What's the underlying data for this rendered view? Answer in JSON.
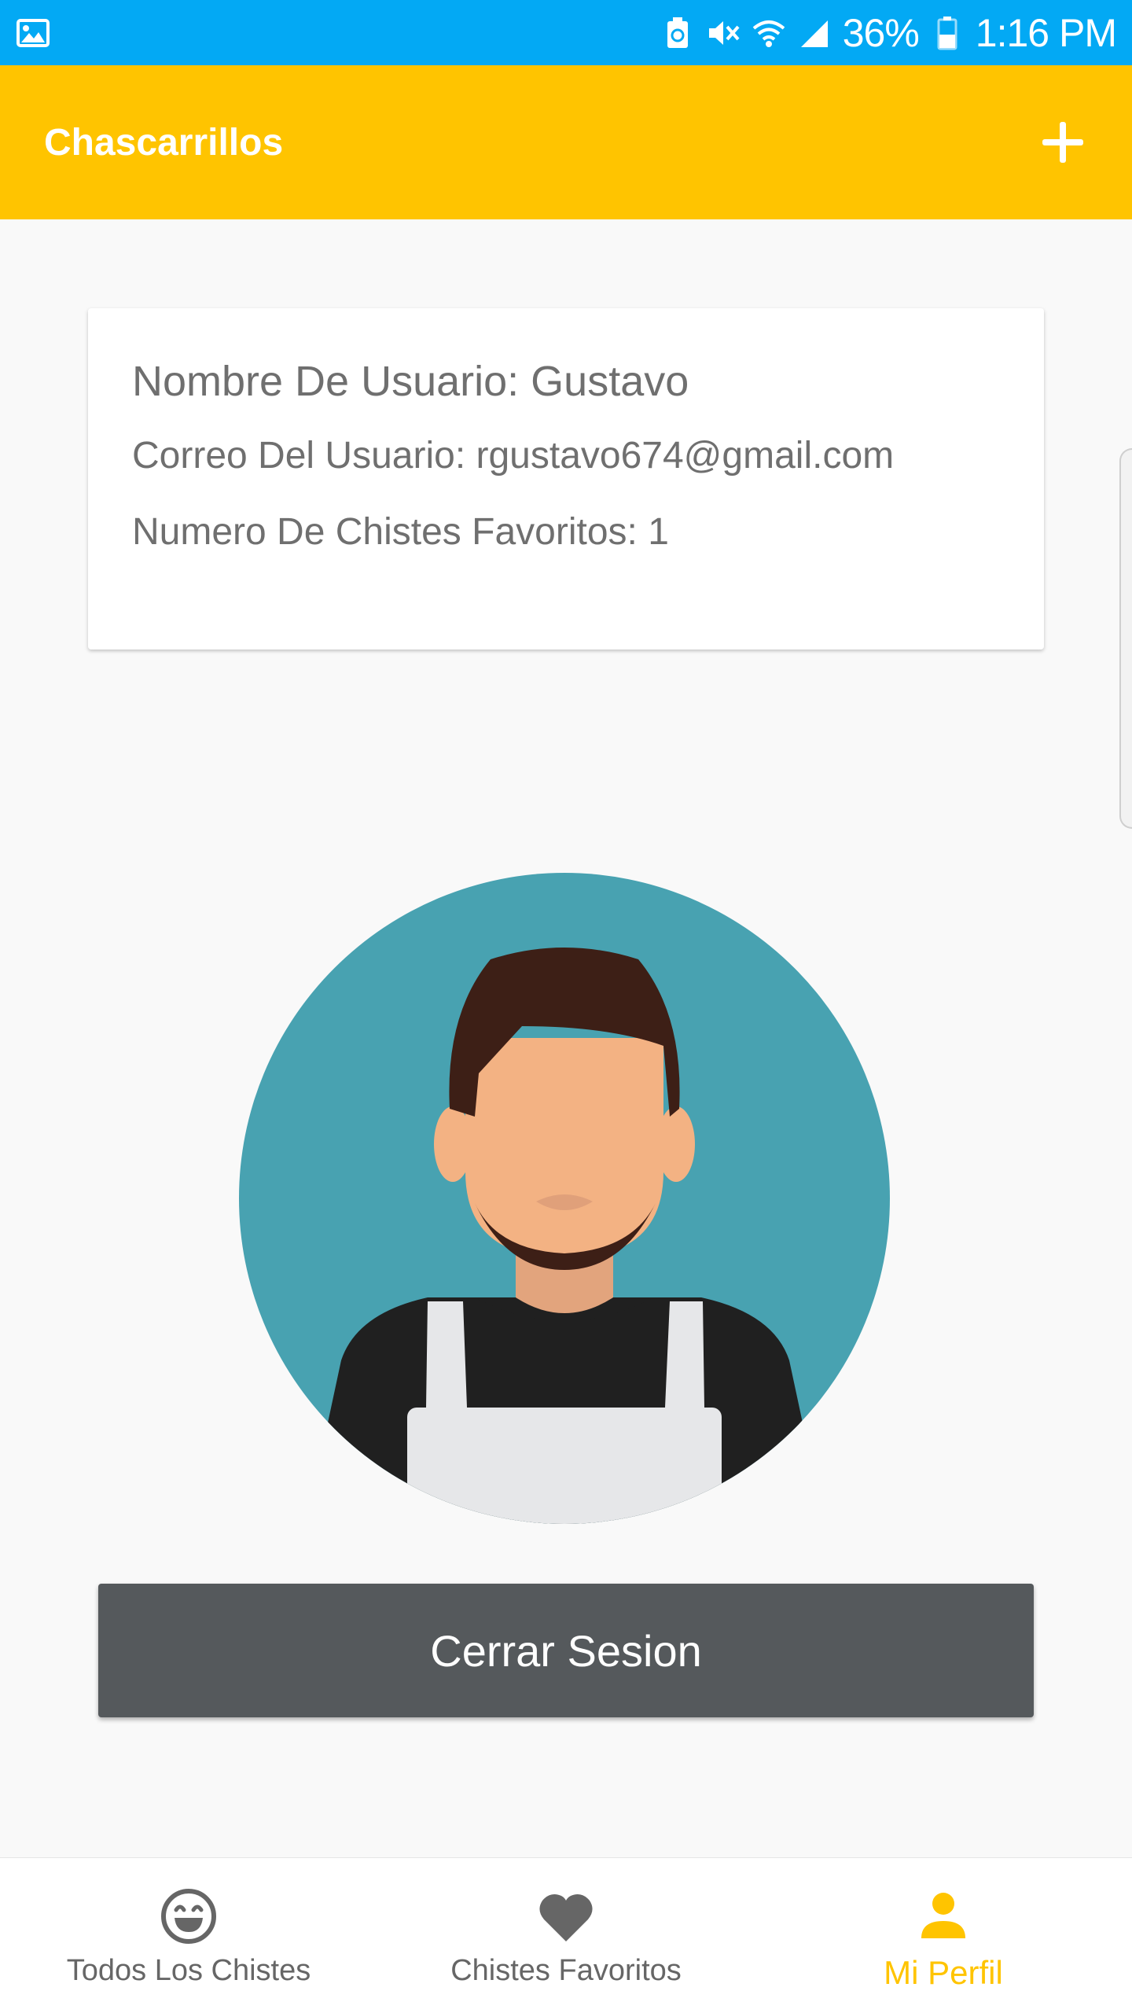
{
  "status_bar": {
    "battery_percent": "36%",
    "time": "1:16 PM",
    "icons": [
      "gallery-icon",
      "battery-saver-icon",
      "mute-icon",
      "wifi-icon",
      "signal-icon",
      "battery-icon"
    ]
  },
  "app_bar": {
    "title": "Chascarrillos",
    "add_icon": "plus-icon"
  },
  "profile": {
    "name_line": "Nombre De Usuario: Gustavo",
    "email_line": "Correo Del Usuario: rgustavo674@gmail.com",
    "favorites_line": "Numero De Chistes Favoritos: 1"
  },
  "logout_button": {
    "label": "Cerrar Sesion"
  },
  "bottom_nav": {
    "items": [
      {
        "label": "Todos Los Chistes",
        "icon": "smiley-icon",
        "active": false
      },
      {
        "label": "Chistes Favoritos",
        "icon": "heart-icon",
        "active": false
      },
      {
        "label": "Mi Perfil",
        "icon": "person-icon",
        "active": true
      }
    ]
  },
  "colors": {
    "status_bar": "#03a9f4",
    "app_bar": "#ffc400",
    "button": "#55595c",
    "active_nav": "#ffc400",
    "avatar_bg": "#48a2b1"
  }
}
